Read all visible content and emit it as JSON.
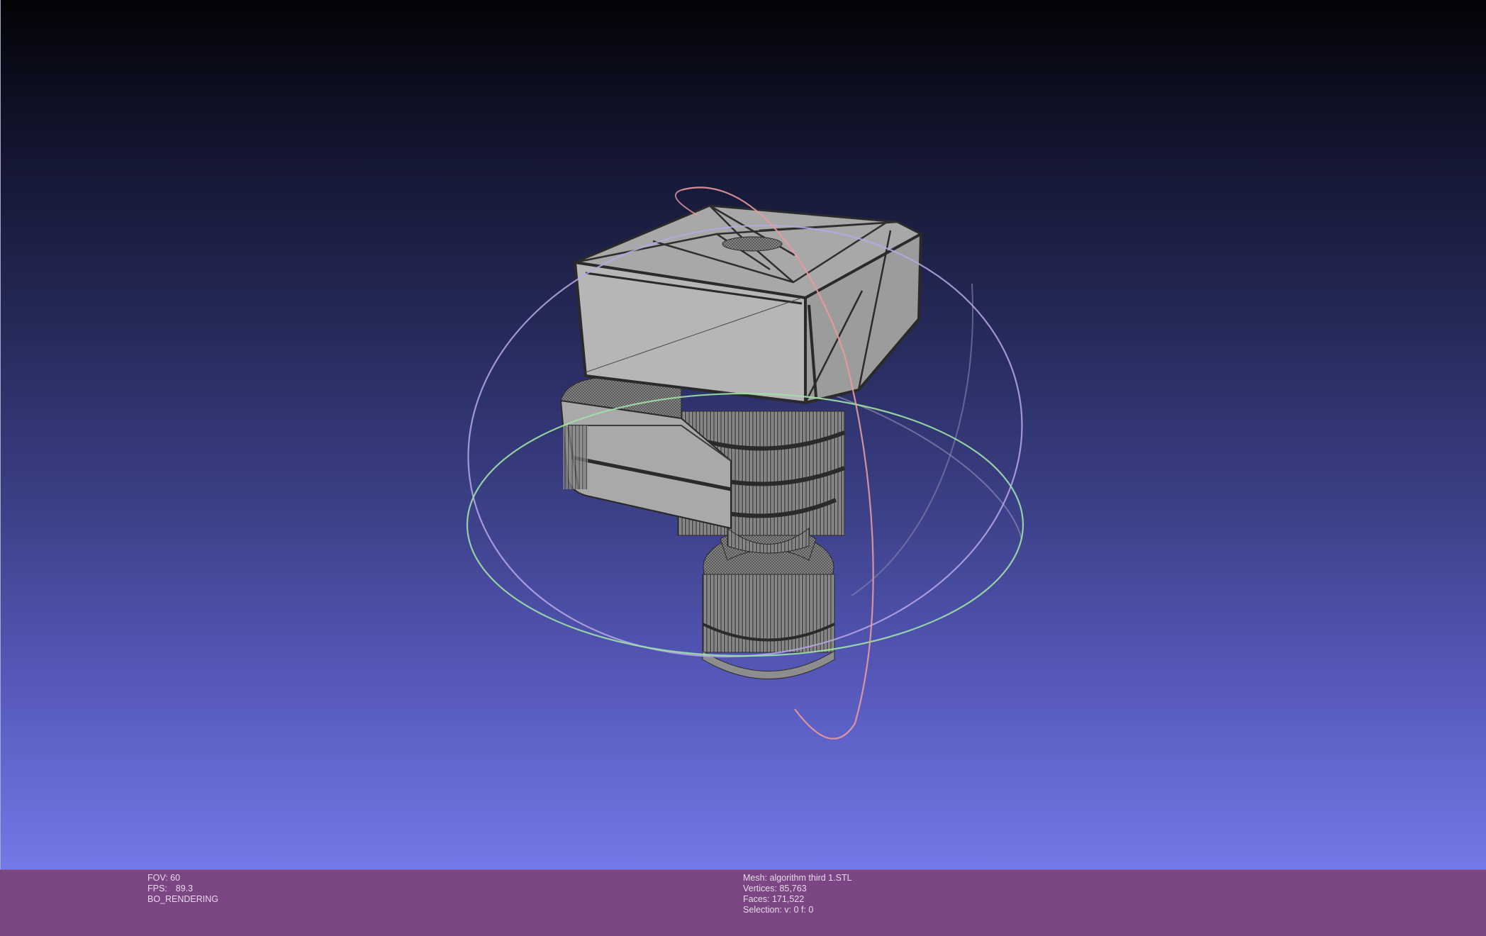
{
  "viewport": {
    "background_top": "#030306",
    "background_bottom": "#7478e8",
    "mesh_color": "#b4b4b4",
    "wire_color": "#2e2e2e",
    "trackball_colors": {
      "x_ring": "#e89aa0",
      "y_ring": "#9ee0a8",
      "z_ring": "#b8a8e8"
    }
  },
  "info_left": {
    "fov_label": "FOV: 60",
    "fps_label": "FPS:",
    "fps_value": "89.3",
    "render_mode": "BO_RENDERING"
  },
  "info_right": {
    "mesh": "Mesh: algorithm third 1.STL",
    "vertices": "Vertices: 85,763",
    "faces": "Faces: 171,522",
    "selection": "Selection: v: 0 f: 0"
  },
  "info_bar_color": "#7c4584"
}
